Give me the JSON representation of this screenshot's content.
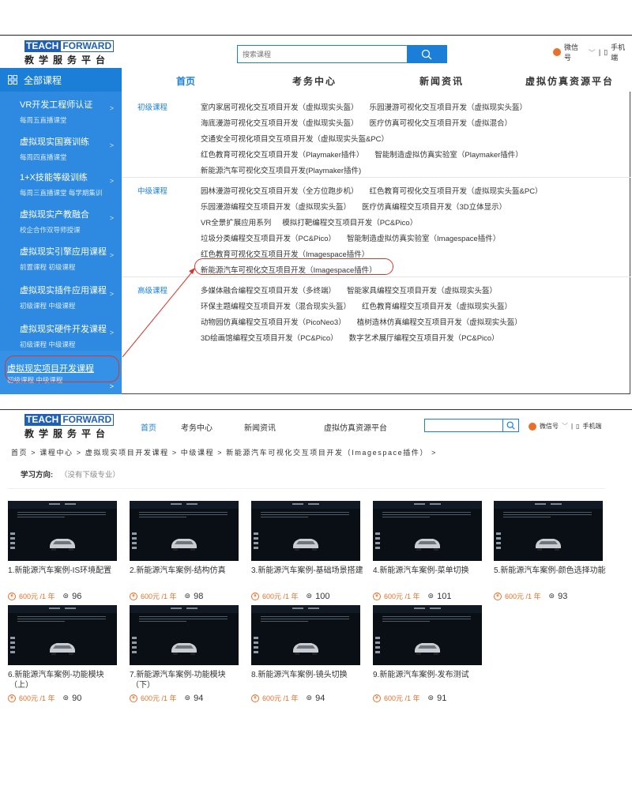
{
  "top": {
    "logo": {
      "left": "TEACH",
      "right": "FORWARD",
      "subtitle": "教学服务平台"
    },
    "search": {
      "placeholder": "搜索课程"
    },
    "links": {
      "wechat": "微信号",
      "divider": "|",
      "mobile": "手机端"
    },
    "nav": {
      "all_courses": "全部课程",
      "items": [
        "首页",
        "考务中心",
        "新闻资讯",
        "虚拟仿真资源平台"
      ]
    },
    "sidebar": [
      {
        "title": "VR开发工程师认证",
        "sub": "每周五直播课堂"
      },
      {
        "title": "虚拟现实国赛训练",
        "sub": "每周四直播课堂"
      },
      {
        "title": "1+X技能等级训练",
        "sub": "每周三直播课堂  每学期集训"
      },
      {
        "title": "虚拟现实产教融合",
        "sub": "校企合作双导师授课"
      },
      {
        "title": "虚拟现实引擎应用课程",
        "sub": "前置课程  初级课程"
      },
      {
        "title": "虚拟现实插件应用课程",
        "sub": "初级课程  中级课程"
      },
      {
        "title": "虚拟现实硬件开发课程",
        "sub": "初级课程  中级课程"
      },
      {
        "title": "虚拟现实项目开发课程",
        "sub": "初级课程  中级课程"
      }
    ],
    "sections": [
      {
        "level": "初级课程",
        "lines": [
          [
            "室内家居可视化交互项目开发（虚拟现实头盔）",
            "乐园漫游可视化交互项目开发（虚拟现实头盔）"
          ],
          [
            "海底漫游可视化交互项目开发（虚拟现实头盔）",
            "医疗仿真可视化交互项目开发（虚拟混合）"
          ],
          [
            "交通安全可视化项目交互项目开发（虚拟现实头盔&PC）"
          ],
          [
            "红色教育可视化交互项目开发（Playmaker插件）",
            "智能制造虚拟仿真实验室（Playmaker插件）"
          ],
          [
            "新能源汽车可视化交互项目开发(Playmaker插件)"
          ]
        ]
      },
      {
        "level": "中级课程",
        "lines": [
          [
            "园林漫游可视化交互项目开发（全方位跑步机）",
            "红色教育可视化交互项目开发（虚拟现实头盔&PC）"
          ],
          [
            "乐园漫游编程交互项目开发（虚拟现实头盔）",
            "医疗仿真编程交互项目开发（3D立体显示）"
          ],
          [
            "VR全景扩展应用系列",
            "模拟打靶编程交互项目开发（PC&Pico）"
          ],
          [
            "垃圾分类编程交互项目开发（PC&Pico）",
            "智能制造虚拟仿真实验室（Imagespace插件）"
          ],
          [
            "红色教育可视化交互项目开发（Imagespace插件）"
          ],
          [
            "新能源汽车可视化交互项目开发（Imagespace插件）"
          ]
        ]
      },
      {
        "level": "高级课程",
        "lines": [
          [
            "多媒体融合编程交互项目开发（多终端）",
            "智能家具编程交互项目开发（虚拟现实头盔）"
          ],
          [
            "环保主题编程交互项目开发（混合现实头盔）",
            "红色教育编程交互项目开发（虚拟现实头盔）"
          ],
          [
            "动物园仿真编程交互项目开发（PicoNeo3）",
            "植树造林仿真编程交互项目开发（虚拟现实头盔）"
          ],
          [
            "3D绘画馆编程交互项目开发（PC&Pico）",
            "数字艺术展厅编程交互项目开发（PC&Pico）"
          ]
        ]
      }
    ]
  },
  "bottom": {
    "logo": {
      "left": "TEACH",
      "right": "FORWARD",
      "subtitle": "教学服务平台"
    },
    "nav": [
      "首页",
      "考务中心",
      "新闻资讯",
      "虚拟仿真资源平台"
    ],
    "links": {
      "wechat": "微信号",
      "divider": "|",
      "mobile": "手机端"
    },
    "breadcrumb": "首页 > 课程中心 > 虚拟现实项目开发课程 > 中级课程 > 新能源汽车可视化交互项目开发（Imagespace插件） >",
    "direction": {
      "label": "学习方向:",
      "value": "（没有下级专业）"
    },
    "cards": [
      {
        "title": "1.新能源汽车案例-IS环境配置",
        "price": "600元 /1 年",
        "views": "96"
      },
      {
        "title": "2.新能源汽车案例-结构仿真",
        "price": "600元 /1 年",
        "views": "98"
      },
      {
        "title": "3.新能源汽车案例-基础场景搭建",
        "price": "600元 /1 年",
        "views": "100"
      },
      {
        "title": "4.新能源汽车案例-菜单切换",
        "price": "600元 /1 年",
        "views": "101"
      },
      {
        "title": "5.新能源汽车案例-颜色选择功能",
        "price": "600元 /1 年",
        "views": "93"
      },
      {
        "title": "6.新能源汽车案例-功能模块（上）",
        "price": "600元 /1 年",
        "views": "90"
      },
      {
        "title": "7.新能源汽车案例-功能模块（下）",
        "price": "600元 /1 年",
        "views": "94"
      },
      {
        "title": "8.新能源汽车案例-镜头切换",
        "price": "600元 /1 年",
        "views": "94"
      },
      {
        "title": "9.新能源汽车案例-发布测试",
        "price": "600元 /1 年",
        "views": "91"
      }
    ],
    "thumb_text": {
      "tab1": "文字介绍",
      "tab2": "颜色选择"
    }
  },
  "colors": {
    "brand": "#1b7fd8",
    "sidebar": "#2d8ae0",
    "price": "#e8702a",
    "highlight": "#d9362b"
  }
}
